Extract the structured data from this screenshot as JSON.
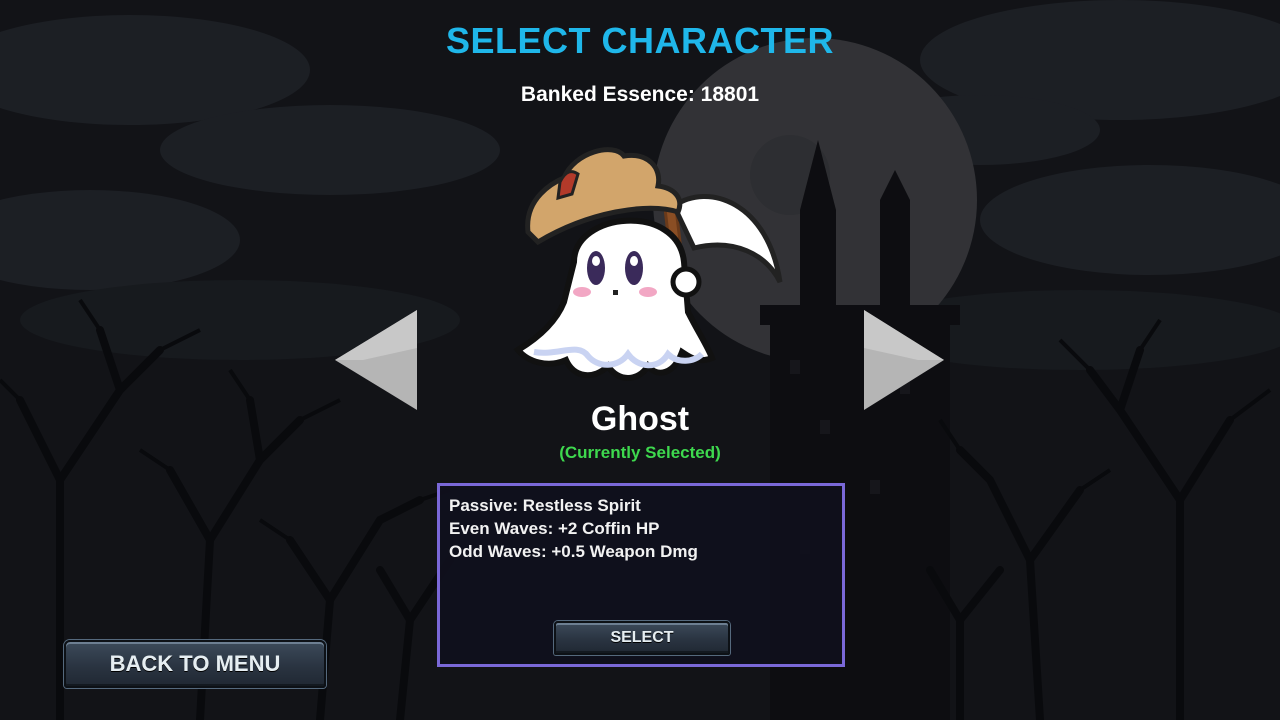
{
  "screen": {
    "title": "SELECT CHARACTER",
    "banked_essence_label": "Banked Essence: 18801"
  },
  "character": {
    "name": "Ghost",
    "status": "(Currently Selected)",
    "portrait_icon": "ghost-with-hat-and-scythe"
  },
  "info_panel": {
    "lines": [
      "Passive: Restless Spirit",
      "Even Waves: +2 Coffin HP",
      "Odd Waves: +0.5 Weapon Dmg"
    ],
    "select_label": "SELECT"
  },
  "nav": {
    "prev_icon": "left-arrow",
    "next_icon": "right-arrow",
    "back_label": "BACK TO MENU"
  },
  "colors": {
    "title": "#1fb7ea",
    "status": "#3ed84e",
    "panel_border": "#7a68d8"
  }
}
